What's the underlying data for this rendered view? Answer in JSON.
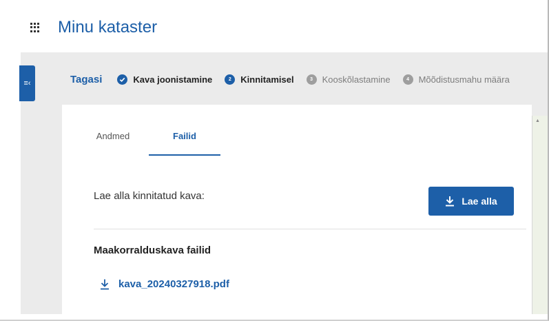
{
  "app": {
    "title": "Minu kataster"
  },
  "stepper": {
    "back_label": "Tagasi",
    "steps": [
      {
        "label": "Kava joonistamine",
        "state": "done",
        "marker": "✓"
      },
      {
        "label": "Kinnitamisel",
        "state": "current",
        "marker": "2"
      },
      {
        "label": "Kooskõlastamine",
        "state": "pending",
        "marker": "3"
      },
      {
        "label": "Mõõdistusmahu määra",
        "state": "pending",
        "marker": "4"
      }
    ]
  },
  "tabs": [
    {
      "label": "Andmed",
      "active": false
    },
    {
      "label": "Failid",
      "active": true
    }
  ],
  "download": {
    "label": "Lae alla kinnitatud kava:",
    "button_label": "Lae alla"
  },
  "files_section": {
    "title": "Maakorralduskava failid",
    "files": [
      {
        "name": "kava_20240327918.pdf"
      }
    ]
  },
  "colors": {
    "accent": "#1d5fa8",
    "background": "#ebebeb",
    "pending_step": "#9e9e9e"
  },
  "icons": {
    "apps": "grid-icon",
    "sidebar_toggle": "collapse-icon",
    "download": "download-icon"
  }
}
